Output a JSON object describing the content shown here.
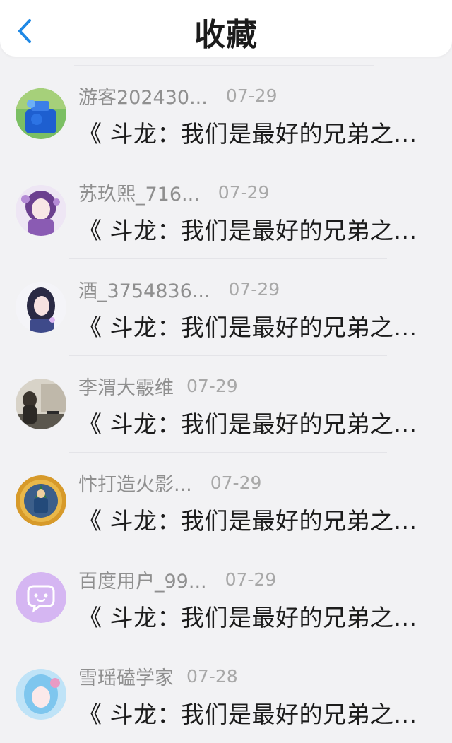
{
  "header": {
    "title": "收藏",
    "back_icon": "chevron-left-icon",
    "accent": "#1e88e5"
  },
  "items": [
    {
      "name": "游客202430...",
      "date": "07-29",
      "text": "《 斗龙：我们是最好的兄弟之...",
      "avatar": "blue-bottle-avatar"
    },
    {
      "name": "苏玖熙_716...",
      "date": "07-29",
      "text": "《 斗龙：我们是最好的兄弟之...",
      "avatar": "anime-girl-purple-avatar"
    },
    {
      "name": "酒_3754836...",
      "date": "07-29",
      "text": "《 斗龙：我们是最好的兄弟之...",
      "avatar": "anime-girl-dark-hair-avatar"
    },
    {
      "name": "李渭大霰维",
      "date": "07-29",
      "text": "《 斗龙：我们是最好的兄弟之...",
      "avatar": "man-sitting-avatar"
    },
    {
      "name": "忭打造火影...",
      "date": "07-29",
      "text": "《 斗龙：我们是最好的兄弟之...",
      "avatar": "ninja-badge-avatar"
    },
    {
      "name": "百度用户_99...",
      "date": "07-29",
      "text": "《 斗龙：我们是最好的兄弟之...",
      "avatar": "default-chat-bubble-avatar"
    },
    {
      "name": "雪瑶磕学家",
      "date": "07-28",
      "text": "《 斗龙：我们是最好的兄弟之...",
      "avatar": "anime-girl-blue-avatar"
    }
  ]
}
